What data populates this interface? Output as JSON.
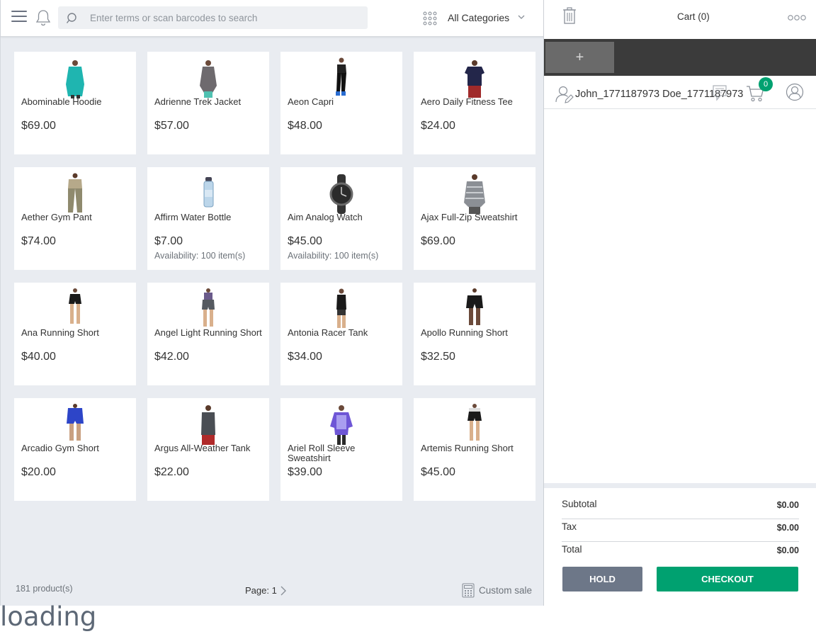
{
  "header": {
    "search_placeholder": "Enter terms or scan barcodes to search",
    "category_label": "All Categories"
  },
  "products": [
    {
      "name": "Abominable Hoodie",
      "price": "$69.00",
      "availability": "",
      "icon": "teal-hoodie"
    },
    {
      "name": "Adrienne Trek Jacket",
      "price": "$57.00",
      "availability": "",
      "icon": "grey-jacket"
    },
    {
      "name": "Aeon Capri",
      "price": "$48.00",
      "availability": "",
      "icon": "black-capri"
    },
    {
      "name": "Aero Daily Fitness Tee",
      "price": "$24.00",
      "availability": "",
      "icon": "navy-tee"
    },
    {
      "name": "Aether Gym Pant",
      "price": "$74.00",
      "availability": "",
      "icon": "khaki-pant"
    },
    {
      "name": "Affirm Water Bottle",
      "price": "$7.00",
      "availability": "Availability: 100 item(s)",
      "icon": "water-bottle"
    },
    {
      "name": "Aim Analog Watch",
      "price": "$45.00",
      "availability": "Availability: 100 item(s)",
      "icon": "analog-watch"
    },
    {
      "name": "Ajax Full-Zip Sweatshirt",
      "price": "$69.00",
      "availability": "",
      "icon": "striped-sweatshirt"
    },
    {
      "name": "Ana Running Short",
      "price": "$40.00",
      "availability": "",
      "icon": "black-short"
    },
    {
      "name": "Angel Light Running Short",
      "price": "$42.00",
      "availability": "",
      "icon": "grey-short"
    },
    {
      "name": "Antonia Racer Tank",
      "price": "$34.00",
      "availability": "",
      "icon": "black-tank"
    },
    {
      "name": "Apollo Running Short",
      "price": "$32.50",
      "availability": "",
      "icon": "black-running-short"
    },
    {
      "name": "Arcadio Gym Short",
      "price": "$20.00",
      "availability": "",
      "icon": "blue-short"
    },
    {
      "name": "Argus All-Weather Tank",
      "price": "$22.00",
      "availability": "",
      "icon": "grey-tank"
    },
    {
      "name": "Ariel Roll Sleeve Sweatshirt",
      "price": "$39.00",
      "availability": "",
      "icon": "purple-sweatshirt"
    },
    {
      "name": "Artemis Running Short",
      "price": "$45.00",
      "availability": "",
      "icon": "black-white-short"
    }
  ],
  "footer": {
    "product_count": "181 product(s)",
    "page": "Page: 1",
    "custom_sale": "Custom sale"
  },
  "loading_text": "loading",
  "cart": {
    "title": "Cart (0)",
    "add_tab": "+",
    "customer_name": "John_1771187973 Doe_1771187973",
    "item_badge": "0",
    "subtotal_label": "Subtotal",
    "subtotal_value": "$0.00",
    "tax_label": "Tax",
    "tax_value": "$0.00",
    "total_label": "Total",
    "total_value": "$0.00",
    "hold_label": "HOLD",
    "checkout_label": "CHECKOUT"
  },
  "colors": {
    "accent": "#00a170",
    "hold": "#6d7788",
    "background": "#e9ecf1"
  }
}
